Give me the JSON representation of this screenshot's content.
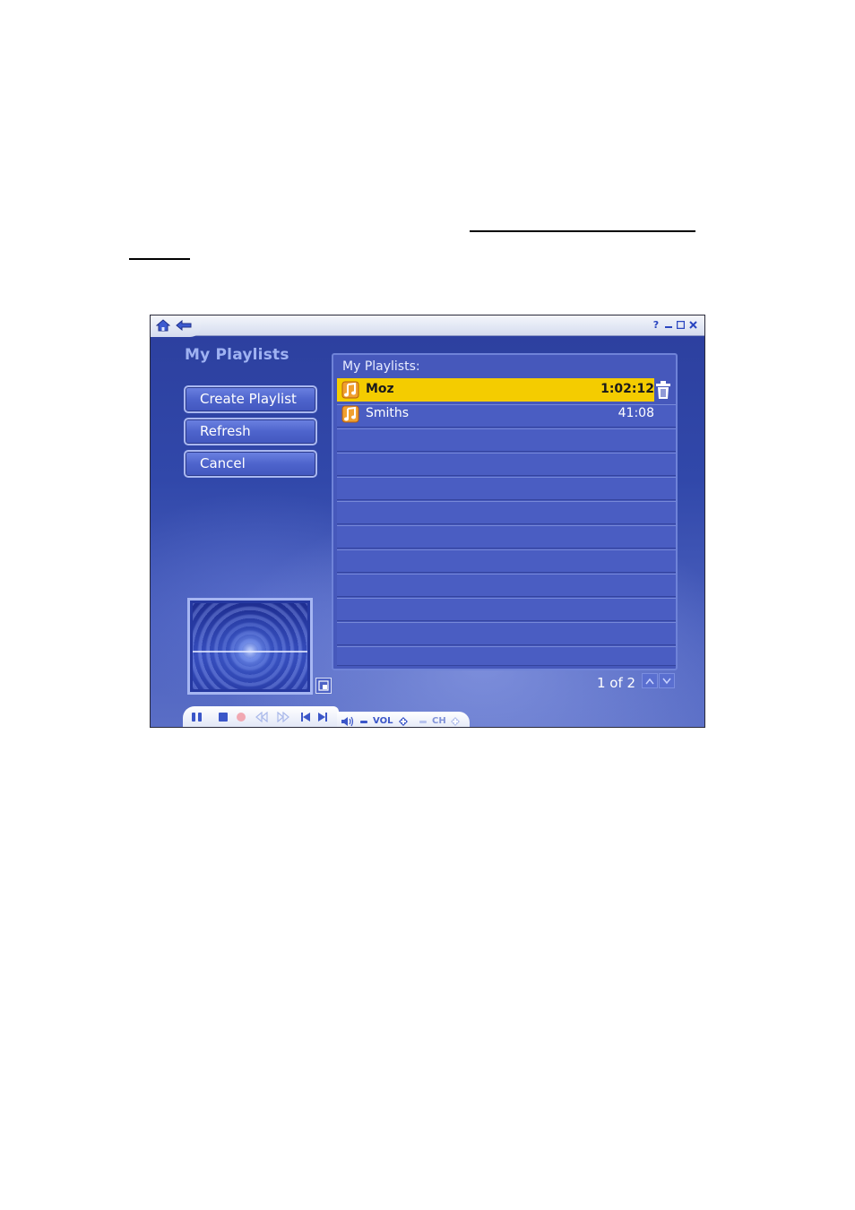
{
  "window": {
    "nav": {
      "home_icon": "home-icon",
      "back_icon": "back-arrow-icon"
    },
    "controls": {
      "help": "?",
      "minimize": "-",
      "maximize": "□",
      "close": "x"
    }
  },
  "page": {
    "title": "My Playlists",
    "buttons": {
      "create": "Create Playlist",
      "refresh": "Refresh",
      "cancel": "Cancel"
    }
  },
  "list": {
    "header": "My Playlists:",
    "items": [
      {
        "name": "Moz",
        "duration": "1:02:12",
        "selected": true,
        "icon": "music-note-icon"
      },
      {
        "name": "Smiths",
        "duration": "41:08",
        "selected": false,
        "icon": "music-note-icon"
      }
    ],
    "page_indicator": "1 of 2"
  },
  "transport": {
    "vol_label": "VOL",
    "ch_label": "CH"
  },
  "colors": {
    "selection": "#f4cc00",
    "panel": "#4658bb",
    "background": "#3148aa"
  }
}
